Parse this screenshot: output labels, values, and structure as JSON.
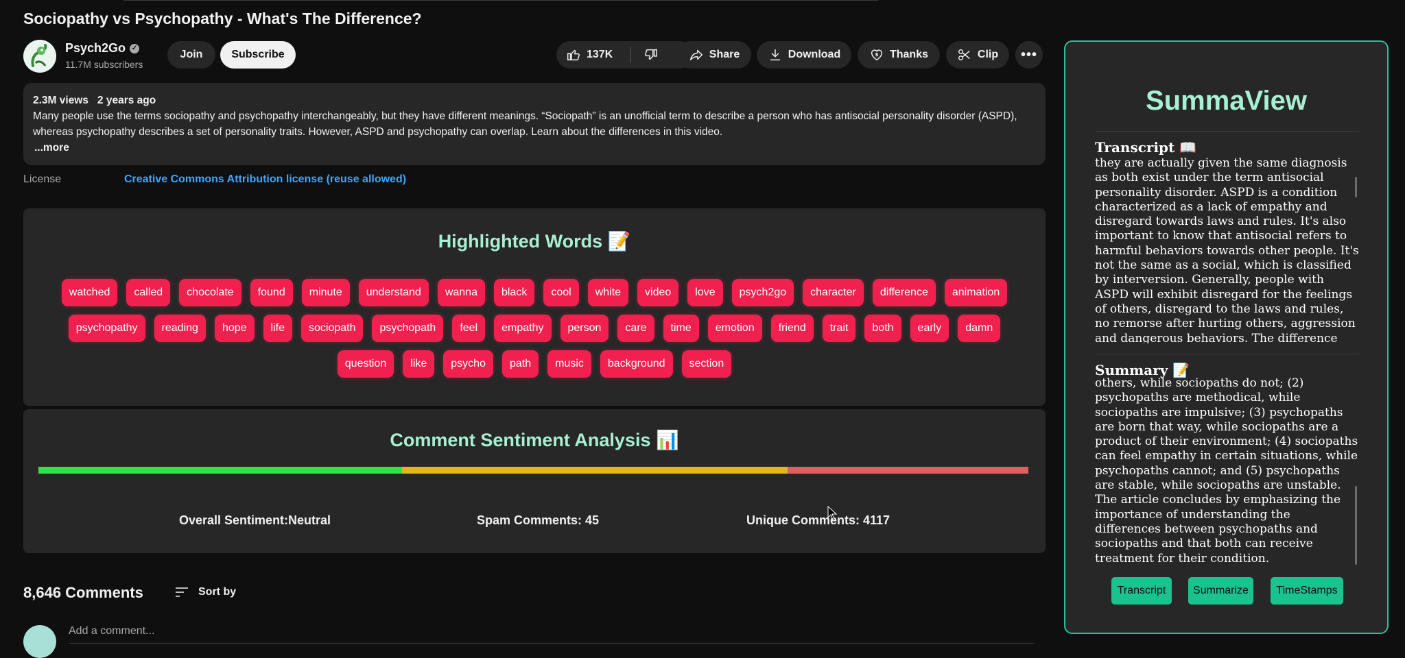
{
  "video": {
    "title": "Sociopathy vs Psychopathy - What's The Difference?",
    "channel_name": "Psych2Go",
    "subscribers": "11.7M subscribers",
    "join_label": "Join",
    "subscribe_label": "Subscribe",
    "like_count": "137K",
    "share_label": "Share",
    "download_label": "Download",
    "thanks_label": "Thanks",
    "clip_label": "Clip"
  },
  "description": {
    "views": "2.3M views",
    "age": "2 years ago",
    "text": "Many people use the terms sociopathy and psychopathy interchangeably, but they have different meanings. “Sociopath” is an unofficial term to describe a person who has antisocial personality disorder (ASPD), whereas psychopathy describes a set of personality traits. However, ASPD and psychopathy can overlap. Learn about the differences in this video.",
    "more_label": "...more"
  },
  "license": {
    "label": "License",
    "value": "Creative Commons Attribution license (reuse allowed)"
  },
  "highlighted": {
    "title": "Highlighted Words 📝",
    "words": [
      "watched",
      "called",
      "chocolate",
      "found",
      "minute",
      "understand",
      "wanna",
      "black",
      "cool",
      "white",
      "video",
      "love",
      "psych2go",
      "character",
      "difference",
      "animation",
      "psychopathy",
      "reading",
      "hope",
      "life",
      "sociopath",
      "psychopath",
      "feel",
      "empathy",
      "person",
      "care",
      "time",
      "emotion",
      "friend",
      "trait",
      "both",
      "early",
      "damn",
      "question",
      "like",
      "psycho",
      "path",
      "music",
      "background",
      "section"
    ]
  },
  "sentiment": {
    "title": "Comment Sentiment Analysis 📊",
    "positive_fraction": 0.367,
    "neutral_fraction": 0.39,
    "negative_fraction": 0.243,
    "colors": {
      "positive": "#2fe24a",
      "neutral": "#e2b71c",
      "negative": "#e06060"
    },
    "overall_label": "Overall Sentiment:",
    "overall_value": "Neutral",
    "spam": "Spam Comments: 45",
    "unique": "Unique Comments: 4117"
  },
  "comments": {
    "count": "8,646 Comments",
    "sort_label": "Sort by",
    "add_placeholder": "Add a comment..."
  },
  "summaview": {
    "title": "SummaView",
    "transcript_heading": "Transcript 📖",
    "transcript_text": "they are actually given the same diagnosis as both exist under the term antisocial personality disorder. ASPD is a condition characterized as a lack of empathy and disregard towards laws and rules. It's also important to know that antisocial refers to harmful behaviors towards other people. It's not the same as a social, which is classified by interversion. Generally, people with ASPD will exhibit disregard for the feelings of others, disregard to the laws and rules, no remorse after hurting others, aggression and dangerous behaviors. The difference lies in",
    "summary_heading": "Summary 📝",
    "summary_text": "others, while sociopaths do not; (2) psychopaths are methodical, while sociopaths are impulsive; (3) psychopaths are born that way, while sociopaths are a product of their environment; (4) sociopaths can feel empathy in certain situations, while psychopaths cannot; and (5) psychopaths are stable, while sociopaths are unstable. The article concludes by emphasizing the importance of understanding the differences between psychopaths and sociopaths and that both can receive treatment for their condition.",
    "buttons": {
      "transcript": "Transcript",
      "summarize": "Summarize",
      "timestamps": "TimeStamps"
    }
  }
}
